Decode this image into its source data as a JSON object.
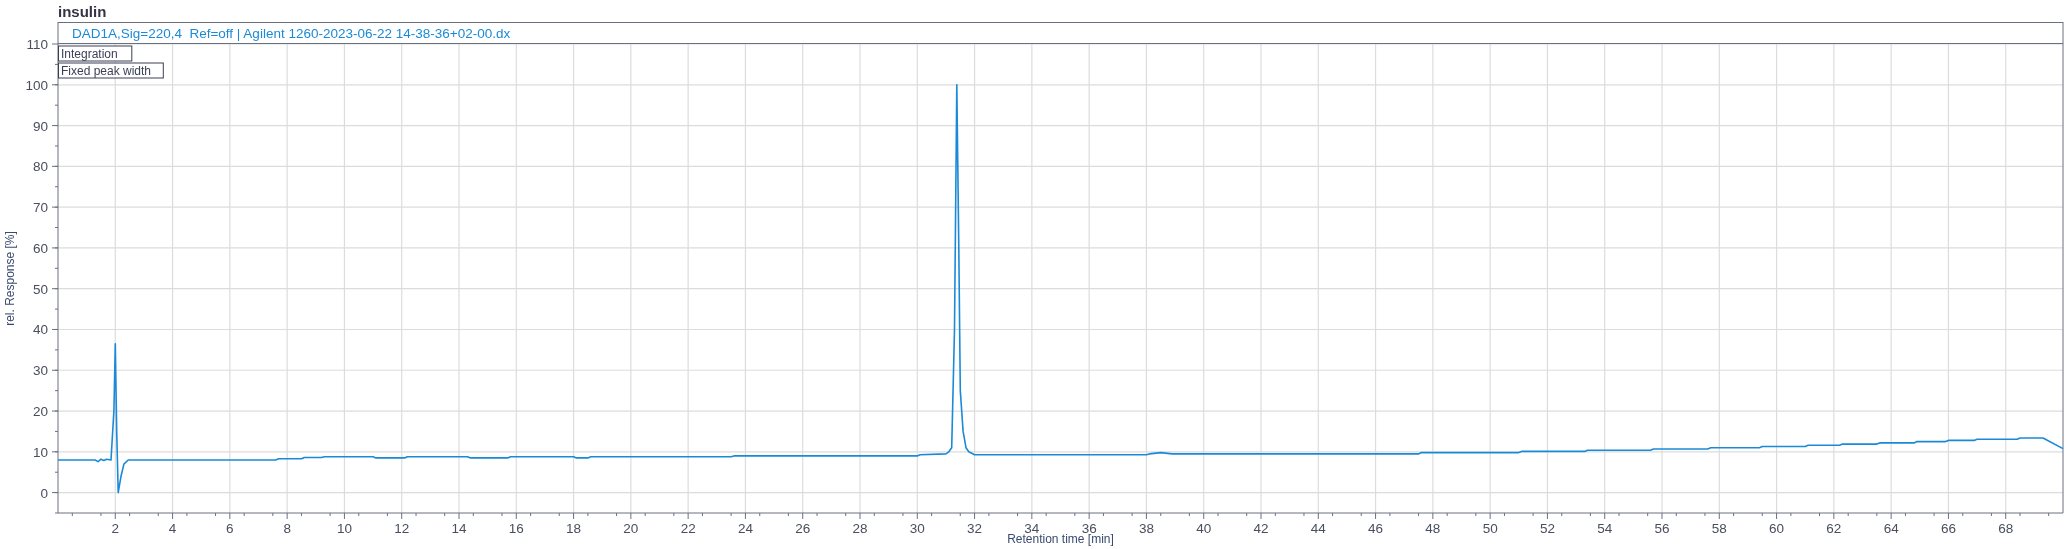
{
  "title": "insulin",
  "chart": {
    "chart_data": {
      "type": "line",
      "grid": true,
      "xlabel": "Retention time [min]",
      "ylabel": "rel. Response [%]",
      "x": [
        0,
        1.3,
        1.4,
        1.5,
        1.6,
        1.7,
        1.85,
        1.95,
        2.0,
        2.05,
        2.1,
        2.2,
        2.3,
        2.45,
        7.6,
        7.7,
        8.5,
        8.6,
        9.2,
        9.3,
        11,
        11.1,
        12.1,
        12.2,
        14.3,
        14.4,
        15.7,
        15.8,
        18,
        18.1,
        18.5,
        18.6,
        23.5,
        23.6,
        30,
        30.1,
        31,
        31.1,
        31.2,
        31.3,
        31.38,
        31.45,
        31.5,
        31.6,
        31.7,
        31.8,
        32,
        38,
        38.1,
        38.5,
        38.9,
        47.5,
        47.6,
        51,
        51.1,
        53.3,
        53.4,
        55.6,
        55.7,
        57.6,
        57.7,
        59.4,
        59.5,
        61,
        61.1,
        62.2,
        62.3,
        63.5,
        63.6,
        64.8,
        64.9,
        65.9,
        66,
        66.9,
        67,
        68.4,
        68.5,
        69.3,
        70
      ],
      "series": [
        {
          "name": "DAD1A,Sig=220,4  Ref=off | Agilent 1260-2023-06-22 14-38-36+02-00.dx",
          "color": "#1a8ad8",
          "values": [
            8,
            8,
            7.6,
            8.2,
            7.9,
            8.2,
            8,
            20,
            36.5,
            15,
            0,
            4,
            7,
            8,
            8,
            8.3,
            8.3,
            8.6,
            8.6,
            8.8,
            8.8,
            8.5,
            8.5,
            8.8,
            8.8,
            8.5,
            8.5,
            8.8,
            8.8,
            8.5,
            8.5,
            8.8,
            8.8,
            9,
            9,
            9.3,
            9.5,
            10,
            11,
            40,
            100,
            60,
            25,
            15,
            11,
            10,
            9.3,
            9.3,
            9.5,
            9.8,
            9.5,
            9.5,
            9.8,
            9.8,
            10.1,
            10.1,
            10.4,
            10.4,
            10.7,
            10.7,
            11,
            11,
            11.3,
            11.3,
            11.6,
            11.6,
            11.9,
            11.9,
            12.2,
            12.2,
            12.5,
            12.5,
            12.8,
            12.8,
            13.1,
            13.1,
            13.4,
            13.4,
            10.8
          ]
        }
      ],
      "xlim": [
        0,
        70
      ],
      "ylim": [
        -5,
        110
      ],
      "xticks": [
        2,
        4,
        6,
        8,
        10,
        12,
        14,
        16,
        18,
        20,
        22,
        24,
        26,
        28,
        30,
        32,
        34,
        36,
        38,
        40,
        42,
        44,
        46,
        48,
        50,
        52,
        54,
        56,
        58,
        60,
        62,
        64,
        66,
        68
      ],
      "yticks": [
        0,
        10,
        20,
        30,
        40,
        50,
        60,
        70,
        80,
        90,
        100,
        110
      ],
      "annotations": [
        "Integration",
        "Fixed peak width"
      ]
    }
  }
}
